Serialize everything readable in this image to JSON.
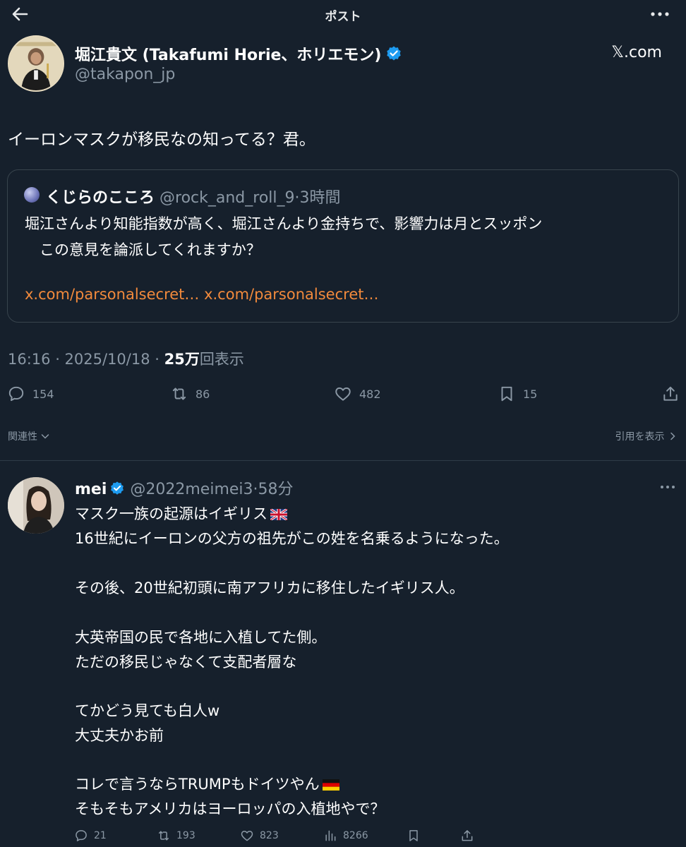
{
  "topbar": {
    "title": "ポスト"
  },
  "post": {
    "author_name": "堀江貴文 (Takafumi Horie、ホリエモン)",
    "author_handle": "@takapon_jp",
    "brand": "𝕏.com",
    "text": "イーロンマスクが移民なの知ってる？君。",
    "quote": {
      "name": "くじらのこころ",
      "meta": " @rock_and_roll_9·3時間",
      "line1": "堀江さんより知能指数が高く、堀江さんより金持ちで、影響力は月とスッポン",
      "line2": "　この意見を論派してくれますか？",
      "link": "x.com/parsonalsecret… x.com/parsonalsecret…"
    },
    "time_date": "16:16 · 2025/10/18 · ",
    "views_count": "25万",
    "views_label": "回表示",
    "actions": {
      "replies": "154",
      "reposts": "86",
      "likes": "482",
      "bookmarks": "15"
    },
    "sort_label": "関連性",
    "quotes_label": "引用を表示"
  },
  "reply": {
    "name": "mei",
    "meta": " @2022meimei3·58分",
    "lines": {
      "l1": "マスク一族の起源はイギリス",
      "l2": "16世紀にイーロンの父方の祖先がこの姓を名乗るようになった。",
      "l3": "その後、20世紀初頭に南アフリカに移住したイギリス人。",
      "l4": "大英帝国の民で各地に入植してた側。",
      "l5": "ただの移民じゃなくて支配者層な",
      "l6": "てかどう見ても白人w",
      "l7": "大丈夫かお前",
      "l8": "コレで言うならTRUMPもドイツやん",
      "l9": "そもそもアメリカはヨーロッパの入植地やで？"
    },
    "actions": {
      "replies": "21",
      "reposts": "193",
      "likes": "823",
      "views": "8266"
    }
  },
  "colors": {
    "background": "#16202c",
    "link": "#f28a3c",
    "verified": "#1d9bf0",
    "muted": "#8b98a5"
  },
  "icons": [
    "back-arrow-icon",
    "more-icon",
    "verified-badge-icon",
    "reply-icon",
    "repost-icon",
    "like-icon",
    "bookmark-icon",
    "share-icon",
    "chevron-down-icon",
    "views-icon",
    "uk-flag-icon",
    "germany-flag-icon"
  ]
}
